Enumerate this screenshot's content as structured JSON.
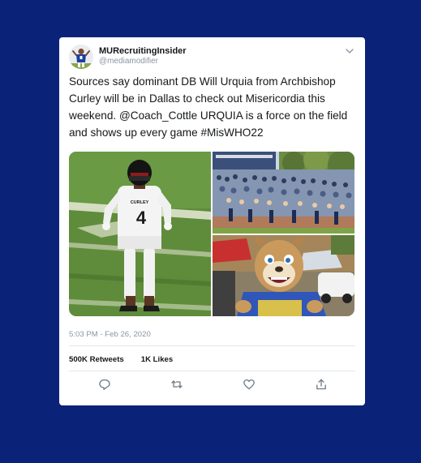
{
  "tweet": {
    "display_name": "MURecruitingInsider",
    "handle": "@mediamodifier",
    "text": "Sources say dominant DB Will Urquia from Archbishop Curley will be in Dallas to check out Misericordia this weekend.  @Coach_Cottle URQUIA is a force on the field and shows up every game  #MisWHO22",
    "timestamp": "5:03 PM - Feb 26, 2020",
    "retweets": "500K Retweets",
    "likes": "1K Likes",
    "media": {
      "jersey_text": "CURLEY",
      "jersey_number": "4"
    }
  },
  "icons": {
    "menu": "chevron-down-icon",
    "reply": "reply-icon",
    "retweet": "retweet-icon",
    "like": "heart-icon",
    "share": "share-icon"
  },
  "colors": {
    "background": "#0a2277",
    "card": "#ffffff",
    "muted_text": "#8a96a3",
    "action_icon": "#6b7883"
  }
}
